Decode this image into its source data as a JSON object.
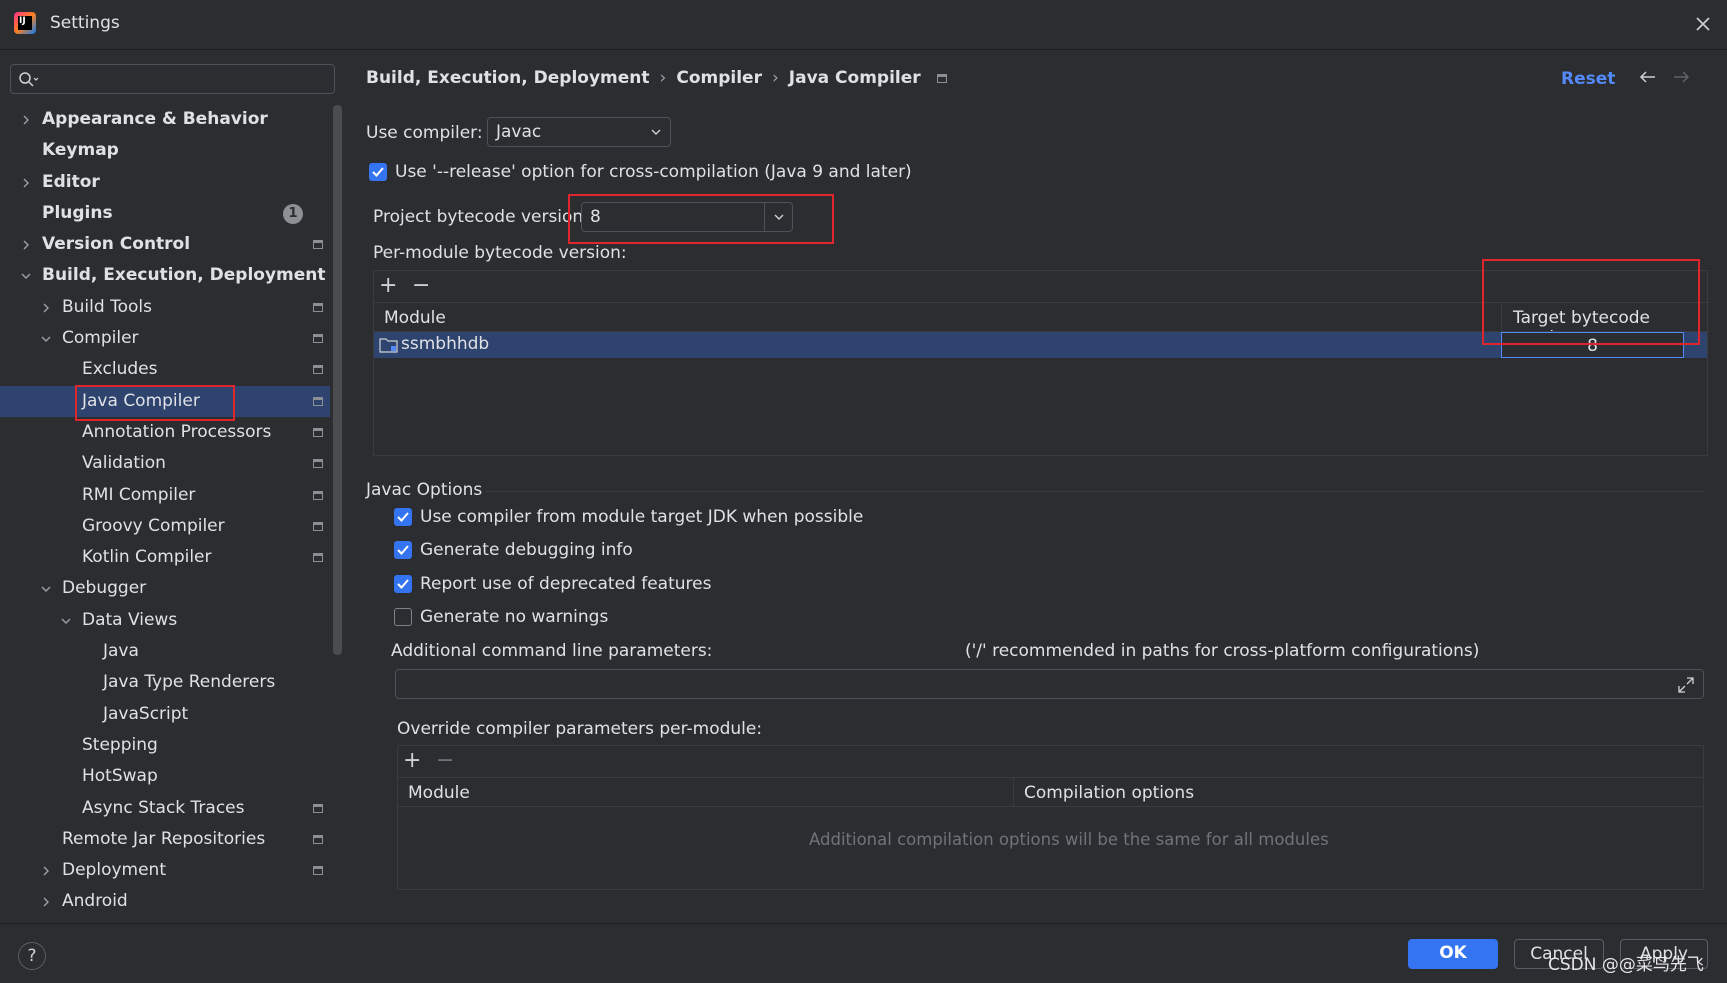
{
  "window": {
    "title": "Settings"
  },
  "search": {
    "placeholder": ""
  },
  "sidebar": {
    "items": [
      {
        "label": "Appearance & Behavior"
      },
      {
        "label": "Keymap"
      },
      {
        "label": "Editor"
      },
      {
        "label": "Plugins",
        "badge": "1"
      },
      {
        "label": "Version Control"
      },
      {
        "label": "Build, Execution, Deployment"
      },
      {
        "label": "Build Tools"
      },
      {
        "label": "Compiler"
      },
      {
        "label": "Excludes"
      },
      {
        "label": "Java Compiler"
      },
      {
        "label": "Annotation Processors"
      },
      {
        "label": "Validation"
      },
      {
        "label": "RMI Compiler"
      },
      {
        "label": "Groovy Compiler"
      },
      {
        "label": "Kotlin Compiler"
      },
      {
        "label": "Debugger"
      },
      {
        "label": "Data Views"
      },
      {
        "label": "Java"
      },
      {
        "label": "Java Type Renderers"
      },
      {
        "label": "JavaScript"
      },
      {
        "label": "Stepping"
      },
      {
        "label": "HotSwap"
      },
      {
        "label": "Async Stack Traces"
      },
      {
        "label": "Remote Jar Repositories"
      },
      {
        "label": "Deployment"
      },
      {
        "label": "Android"
      }
    ]
  },
  "breadcrumb": {
    "part1": "Build, Execution, Deployment",
    "part2": "Compiler",
    "part3": "Java Compiler",
    "sep": "›"
  },
  "header": {
    "reset": "Reset"
  },
  "compiler": {
    "use_compiler_label": "Use compiler:",
    "use_compiler_value": "Javac",
    "release_option_label": "Use '--release' option for cross-compilation (Java 9 and later)",
    "project_bytecode_label": "Project bytecode version",
    "project_bytecode_value": "8",
    "per_module_label": "Per-module bytecode version:"
  },
  "module_table": {
    "columns": [
      "Module",
      "Target bytecode versi..."
    ],
    "rows": [
      {
        "module": "ssmbhhdb",
        "version": "8"
      }
    ]
  },
  "javac": {
    "section_title": "Javac Options",
    "opt1": "Use compiler from module target JDK when possible",
    "opt2": "Generate debugging info",
    "opt3": "Report use of deprecated features",
    "opt4": "Generate no warnings",
    "additional_params_label": "Additional command line parameters:",
    "additional_params_hint": "('/' recommended in paths for cross-platform configurations)",
    "additional_params_value": "",
    "override_label": "Override compiler parameters per-module:",
    "override_columns": [
      "Module",
      "Compilation options"
    ],
    "override_empty": "Additional compilation options will be the same for all modules"
  },
  "footer": {
    "help": "?",
    "ok": "OK",
    "cancel": "Cancel",
    "apply": "Apply",
    "watermark": "CSDN @@菜鸟先飞"
  },
  "colors": {
    "accent": "#3574f0",
    "selection": "#2e436e",
    "highlight_box": "#e0262d",
    "link": "#548af7"
  }
}
